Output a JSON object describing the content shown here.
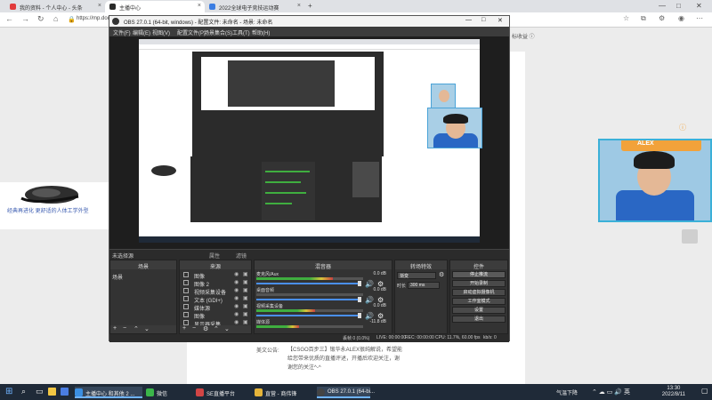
{
  "browser": {
    "tabs": [
      {
        "title": "我的资料 - 个人中心 - 头条",
        "favicon_color": "#e23b3b"
      },
      {
        "title": "主播中心",
        "favicon_color": "#2a2a2a"
      },
      {
        "title": "2022全球电子竞技运动赛",
        "favicon_color": "#3b7de2"
      }
    ],
    "url": "https://mp.douyi",
    "side_text": "标收益 ⓘ"
  },
  "page": {
    "mouse_caption": "经典再进化 更舒适的人体工学外型",
    "source_label": "美文公告:",
    "article_text": "【CSGO百步三】锻华永ALEX很纯解说，希望能给您带来优质的直播评述，开播后欢迎关注，谢谢您的关注^-^",
    "webcam_label": "ALEX",
    "webcam_sub": "ⓘ"
  },
  "obs": {
    "title": "OBS 27.0.1 (64-bit, windows) - 配置文件: 未命名 - 场景: 未命名",
    "menu": [
      "文件(F)",
      "编辑(E)",
      "视图(V)",
      "配置文件(P)",
      "场景集合(S)",
      "工具(T)",
      "帮助(H)"
    ],
    "scene_bar": {
      "label": "未选择源",
      "prop_btn": "属性",
      "filter_btn": "滤镜"
    },
    "panels": {
      "scenes": {
        "title": "场景",
        "items": [
          "场景"
        ]
      },
      "sources": {
        "title": "来源",
        "items": [
          "图像",
          "图像 2",
          "视频采集设备",
          "文本 (GDI+)",
          "媒体源",
          "图像",
          "显示器采集"
        ]
      },
      "mixer": {
        "title": "混音器",
        "channels": [
          {
            "name": "麦克风/Aux",
            "db": "0.0 dB",
            "level": 0.72
          },
          {
            "name": "桌面音频",
            "db": "0.0 dB",
            "level": 0.0
          },
          {
            "name": "视频采集设备",
            "db": "0.0 dB",
            "level": 0.55
          },
          {
            "name": "媒体源",
            "db": "-11.8 dB",
            "level": 0.4
          }
        ]
      },
      "transitions": {
        "title": "转场特效",
        "type": "渐变",
        "duration_label": "时长",
        "duration": "300 ms"
      },
      "controls": {
        "title": "控件",
        "buttons": [
          "停止推流",
          "开始录制",
          "启动虚拟摄像机",
          "工作室模式",
          "设置",
          "退出"
        ]
      }
    },
    "status": {
      "dropped": "丢帧 0 (0.0%)",
      "live": "LIVE: 00:00:00",
      "rec": "REC: 00:00:00",
      "cpu": "CPU: 11.7%, 60.00 fps",
      "bitrate": "kb/s: 0"
    }
  },
  "taskbar": {
    "items": [
      {
        "label": "主播中心 和其他 2 ...",
        "color": "#3b8fe2"
      },
      {
        "label": "微信",
        "color": "#3bb54a"
      },
      {
        "label": "SE直播平台",
        "color": "#d14545"
      },
      {
        "label": "直营 - 商伟锋",
        "color": "#e5b43a"
      },
      {
        "label": "OBS 27.0.1 (64-bi...",
        "color": "#444444"
      }
    ],
    "weather": "气温下降",
    "time": "13:30",
    "date": "2022/8/11"
  }
}
